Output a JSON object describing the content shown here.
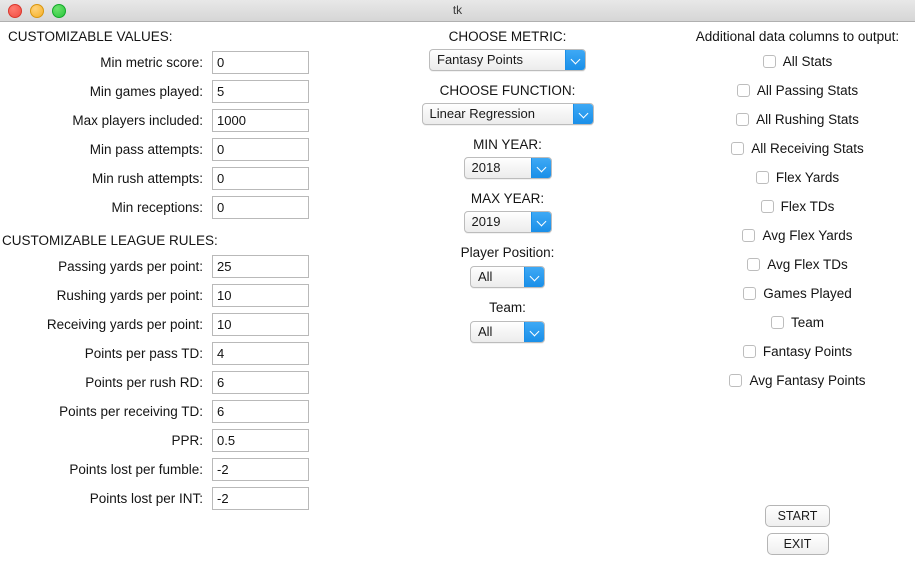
{
  "window": {
    "title": "tk",
    "controls": {
      "close": "close-button",
      "minimize": "minimize-button",
      "maximize": "maximize-button"
    }
  },
  "left_column": {
    "values_heading": "CUSTOMIZABLE VALUES:",
    "values_fields": [
      {
        "label": "Min metric score:",
        "value": "0"
      },
      {
        "label": "Min games played:",
        "value": "5"
      },
      {
        "label": "Max players included:",
        "value": "1000"
      },
      {
        "label": "Min pass attempts:",
        "value": "0"
      },
      {
        "label": "Min rush attempts:",
        "value": "0"
      },
      {
        "label": "Min receptions:",
        "value": "0"
      }
    ],
    "rules_heading": "CUSTOMIZABLE LEAGUE RULES:",
    "rules_fields": [
      {
        "label": "Passing yards per point:",
        "value": "25"
      },
      {
        "label": "Rushing yards per point:",
        "value": "10"
      },
      {
        "label": "Receiving yards per point:",
        "value": "10"
      },
      {
        "label": "Points per pass TD:",
        "value": "4"
      },
      {
        "label": "Points per rush RD:",
        "value": "6"
      },
      {
        "label": "Points per receiving TD:",
        "value": "6"
      },
      {
        "label": "PPR:",
        "value": "0.5"
      },
      {
        "label": "Points lost per fumble:",
        "value": "-2"
      },
      {
        "label": "Points lost per INT:",
        "value": "-2"
      }
    ]
  },
  "middle_column": {
    "metric_heading": "CHOOSE METRIC:",
    "metric_value": "Fantasy Points",
    "function_heading": "CHOOSE FUNCTION:",
    "function_value": "Linear Regression",
    "min_year_heading": "MIN YEAR:",
    "min_year_value": "2018",
    "max_year_heading": "MAX YEAR:",
    "max_year_value": "2019",
    "position_heading": "Player Position:",
    "position_value": "All",
    "team_heading": "Team:",
    "team_value": "All"
  },
  "right_column": {
    "heading": "Additional data columns to output:",
    "checkboxes": [
      {
        "label": "All Stats",
        "checked": false
      },
      {
        "label": "All Passing Stats",
        "checked": false
      },
      {
        "label": "All Rushing Stats",
        "checked": false
      },
      {
        "label": "All Receiving Stats",
        "checked": false
      },
      {
        "label": "Flex Yards",
        "checked": false
      },
      {
        "label": "Flex TDs",
        "checked": false
      },
      {
        "label": "Avg Flex Yards",
        "checked": false
      },
      {
        "label": "Avg Flex TDs",
        "checked": false
      },
      {
        "label": "Games Played",
        "checked": false
      },
      {
        "label": "Team",
        "checked": false
      },
      {
        "label": "Fantasy Points",
        "checked": false
      },
      {
        "label": "Avg Fantasy Points",
        "checked": false
      }
    ],
    "start_button": "START",
    "exit_button": "EXIT"
  },
  "colors": {
    "accent_blue": "#1a8fe8",
    "background": "#ffffff",
    "titlebar": "#e0e0e0",
    "text": "#141414",
    "field_border": "#b9b9b9"
  }
}
